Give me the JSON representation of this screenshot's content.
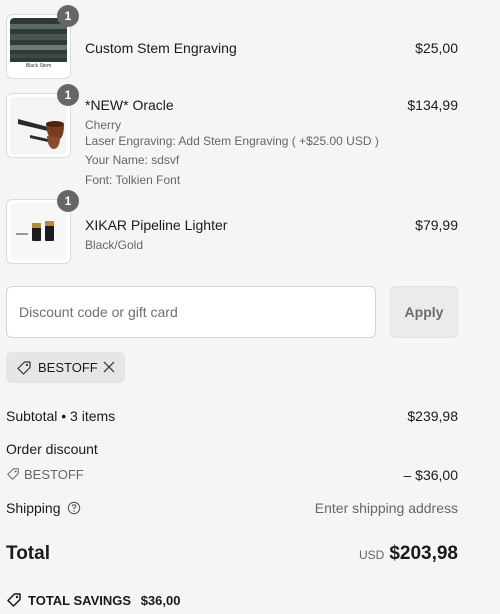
{
  "items": [
    {
      "name": "Custom Stem Engraving",
      "price": "$25,00",
      "quantity": "1",
      "image_caption": "Black Stem",
      "meta": []
    },
    {
      "name": "*NEW* Oracle",
      "price": "$134,99",
      "quantity": "1",
      "image_caption": "",
      "meta": [
        "Cherry",
        "Laser Engraving: Add Stem Engraving ( +$25.00 USD )",
        "Your Name: sdsvf",
        "Font: Tolkien Font"
      ]
    },
    {
      "name": "XIKAR Pipeline Lighter",
      "price": "$79,99",
      "quantity": "1",
      "image_caption": "",
      "meta": [
        "Black/Gold"
      ]
    }
  ],
  "discount": {
    "placeholder": "Discount code or gift card",
    "apply_label": "Apply",
    "applied_code": "BESTOFF"
  },
  "summary": {
    "subtotal_label": "Subtotal • 3 items",
    "subtotal_value": "$239,98",
    "order_discount_label": "Order discount",
    "discount_code": "BESTOFF",
    "discount_value": "– $36,00",
    "shipping_label": "Shipping",
    "shipping_value": "Enter shipping address",
    "total_label": "Total",
    "currency": "USD",
    "total_value": "$203,98",
    "savings_label": "TOTAL SAVINGS",
    "savings_value": "$36,00"
  }
}
